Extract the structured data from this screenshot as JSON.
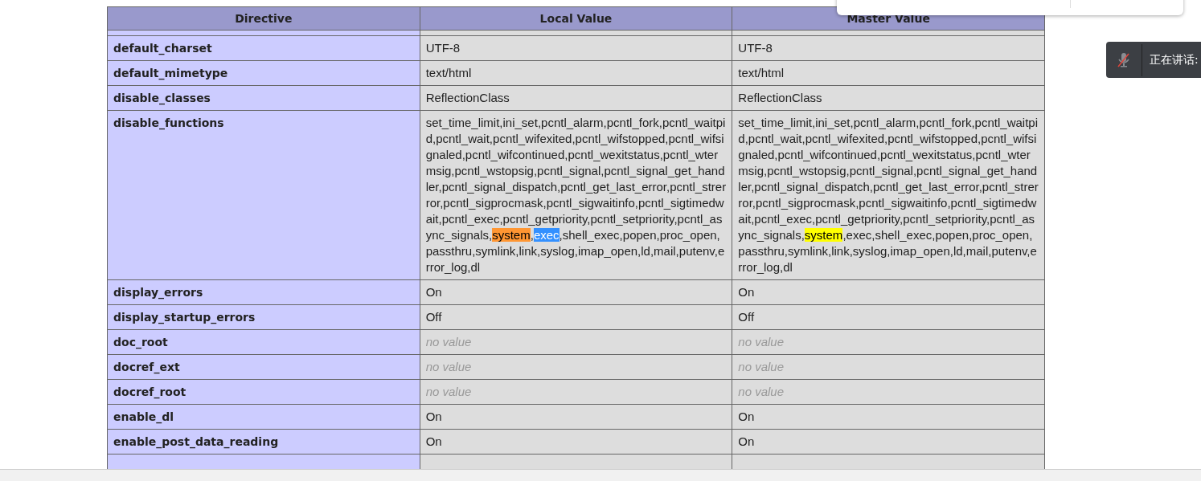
{
  "table": {
    "columns": [
      "Directive",
      "Local Value",
      "Master Value"
    ],
    "rows": [
      {
        "directive": "default_charset",
        "local": {
          "no_value": false,
          "parts": [
            {
              "text": "UTF-8",
              "kind": "plain"
            }
          ]
        },
        "master": {
          "no_value": false,
          "parts": [
            {
              "text": "UTF-8",
              "kind": "plain"
            }
          ]
        }
      },
      {
        "directive": "default_mimetype",
        "local": {
          "no_value": false,
          "parts": [
            {
              "text": "text/html",
              "kind": "plain"
            }
          ]
        },
        "master": {
          "no_value": false,
          "parts": [
            {
              "text": "text/html",
              "kind": "plain"
            }
          ]
        }
      },
      {
        "directive": "disable_classes",
        "local": {
          "no_value": false,
          "parts": [
            {
              "text": "ReflectionClass",
              "kind": "plain"
            }
          ]
        },
        "master": {
          "no_value": false,
          "parts": [
            {
              "text": "ReflectionClass",
              "kind": "plain"
            }
          ]
        }
      },
      {
        "directive": "disable_functions",
        "local": {
          "no_value": false,
          "parts": [
            {
              "text": "set_time_limit,ini_set,pcntl_alarm,pcntl_fork,pcntl_waitpid,pcntl_wait,pcntl_wifexited,pcntl_wifstopped,pcntl_wifsignaled,pcntl_wifcontinued,pcntl_wexitstatus,pcntl_wtermsig,pcntl_wstopsig,pcntl_signal,pcntl_signal_get_handler,pcntl_signal_dispatch,pcntl_get_last_error,pcntl_strerror,pcntl_sigprocmask,pcntl_sigwaitinfo,pcntl_sigtimedwait,pcntl_exec,pcntl_getpriority,pcntl_setpriority,pcntl_async_signals,",
              "kind": "plain"
            },
            {
              "text": "system",
              "kind": "current-match"
            },
            {
              "text": ",",
              "kind": "plain"
            },
            {
              "text": "exec",
              "kind": "selection"
            },
            {
              "text": ",shell_exec,popen,proc_open,passthru,symlink,link,syslog,imap_open,ld,mail,putenv,error_log,dl",
              "kind": "plain"
            }
          ]
        },
        "master": {
          "no_value": false,
          "parts": [
            {
              "text": "set_time_limit,ini_set,pcntl_alarm,pcntl_fork,pcntl_waitpid,pcntl_wait,pcntl_wifexited,pcntl_wifstopped,pcntl_wifsignaled,pcntl_wifcontinued,pcntl_wexitstatus,pcntl_wtermsig,pcntl_wstopsig,pcntl_signal,pcntl_signal_get_handler,pcntl_signal_dispatch,pcntl_get_last_error,pcntl_strerror,pcntl_sigprocmask,pcntl_sigwaitinfo,pcntl_sigtimedwait,pcntl_exec,pcntl_getpriority,pcntl_setpriority,pcntl_async_signals,",
              "kind": "plain"
            },
            {
              "text": "system",
              "kind": "match"
            },
            {
              "text": ",exec,shell_exec,popen,proc_open,passthru,symlink,link,syslog,imap_open,ld,mail,putenv,error_log,dl",
              "kind": "plain"
            }
          ]
        }
      },
      {
        "directive": "display_errors",
        "local": {
          "no_value": false,
          "parts": [
            {
              "text": "On",
              "kind": "plain"
            }
          ]
        },
        "master": {
          "no_value": false,
          "parts": [
            {
              "text": "On",
              "kind": "plain"
            }
          ]
        }
      },
      {
        "directive": "display_startup_errors",
        "local": {
          "no_value": false,
          "parts": [
            {
              "text": "Off",
              "kind": "plain"
            }
          ]
        },
        "master": {
          "no_value": false,
          "parts": [
            {
              "text": "Off",
              "kind": "plain"
            }
          ]
        }
      },
      {
        "directive": "doc_root",
        "local": {
          "no_value": true,
          "parts": [
            {
              "text": "no value",
              "kind": "plain"
            }
          ]
        },
        "master": {
          "no_value": true,
          "parts": [
            {
              "text": "no value",
              "kind": "plain"
            }
          ]
        }
      },
      {
        "directive": "docref_ext",
        "local": {
          "no_value": true,
          "parts": [
            {
              "text": "no value",
              "kind": "plain"
            }
          ]
        },
        "master": {
          "no_value": true,
          "parts": [
            {
              "text": "no value",
              "kind": "plain"
            }
          ]
        }
      },
      {
        "directive": "docref_root",
        "local": {
          "no_value": true,
          "parts": [
            {
              "text": "no value",
              "kind": "plain"
            }
          ]
        },
        "master": {
          "no_value": true,
          "parts": [
            {
              "text": "no value",
              "kind": "plain"
            }
          ]
        }
      },
      {
        "directive": "enable_dl",
        "local": {
          "no_value": false,
          "parts": [
            {
              "text": "On",
              "kind": "plain"
            }
          ]
        },
        "master": {
          "no_value": false,
          "parts": [
            {
              "text": "On",
              "kind": "plain"
            }
          ]
        }
      },
      {
        "directive": "enable_post_data_reading",
        "local": {
          "no_value": false,
          "parts": [
            {
              "text": "On",
              "kind": "plain"
            }
          ]
        },
        "master": {
          "no_value": false,
          "parts": [
            {
              "text": "On",
              "kind": "plain"
            }
          ]
        }
      }
    ]
  },
  "toast": {
    "muted": true,
    "text": "正在讲话:"
  }
}
